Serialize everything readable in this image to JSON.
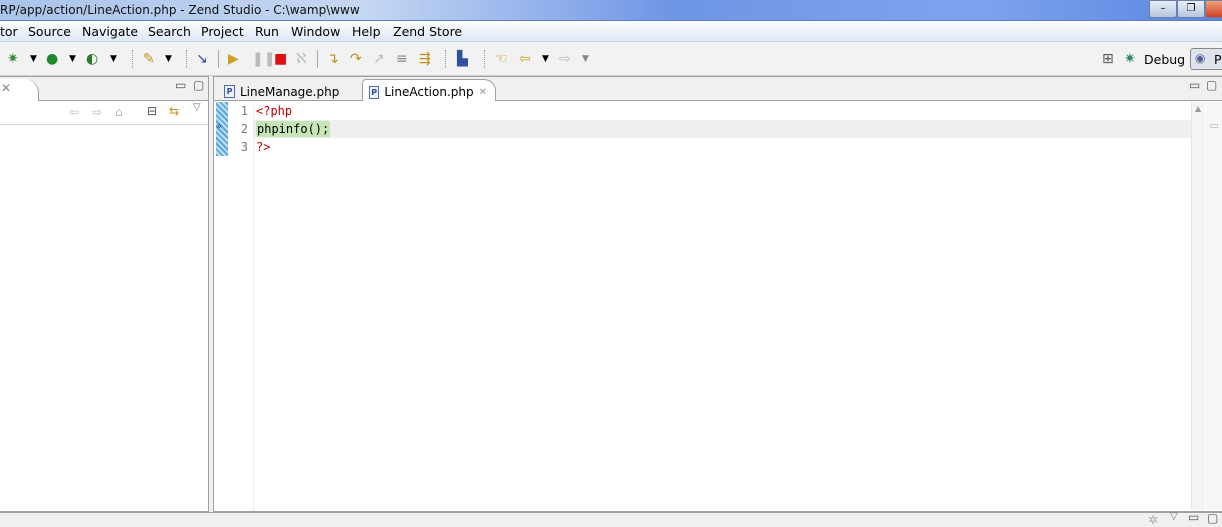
{
  "window": {
    "title": "RP/app/action/LineAction.php - Zend Studio - C:\\wamp\\www"
  },
  "menu": [
    "tor",
    "Source",
    "Navigate",
    "Search",
    "Project",
    "Run",
    "Window",
    "Help",
    "Zend Store"
  ],
  "perspectives": {
    "debug": "Debug",
    "php": "P"
  },
  "editor": {
    "tabs": [
      {
        "label": "LineManage.php",
        "active": false
      },
      {
        "label": "LineAction.php",
        "active": true
      }
    ],
    "lines": [
      {
        "n": "1",
        "text": "<?php",
        "color": "#c00000"
      },
      {
        "n": "2",
        "text": "phpinfo();",
        "color": "#000000"
      },
      {
        "n": "3",
        "text": "?>",
        "color": "#c00000"
      }
    ],
    "current_line": 2
  },
  "colors": {
    "keyword": "#c00000",
    "highlight": "#c7e6b8",
    "current_line": "#efefef"
  }
}
